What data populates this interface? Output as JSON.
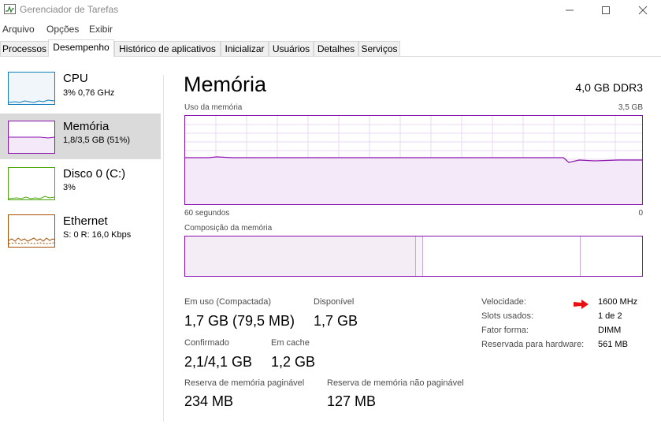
{
  "window": {
    "title": "Gerenciador de Tarefas"
  },
  "menu": [
    "Arquivo",
    "Opções",
    "Exibir"
  ],
  "tabs": [
    "Processos",
    "Desempenho",
    "Histórico de aplicativos",
    "Inicializar",
    "Usuários",
    "Detalhes",
    "Serviços"
  ],
  "active_tab": "Desempenho",
  "sidebar": {
    "items": [
      {
        "title": "CPU",
        "subtitle": "3% 0,76 GHz",
        "color": "#117dbb"
      },
      {
        "title": "Memória",
        "subtitle": "1,8/3,5 GB (51%)",
        "color": "#8b12ae"
      },
      {
        "title": "Disco 0 (C:)",
        "subtitle": "3%",
        "color": "#4da60c"
      },
      {
        "title": "Ethernet",
        "subtitle": "S: 0 R: 16,0 Kbps",
        "color": "#a74f01"
      }
    ]
  },
  "main": {
    "title": "Memória",
    "spec": "4,0 GB DDR3",
    "usage_label": "Uso da memória",
    "usage_max": "3,5 GB",
    "time_left": "60 segundos",
    "time_right": "0",
    "composition_label": "Composição da memória",
    "usage_level_fraction": 0.51,
    "composition": {
      "in_use_fraction": 0.505,
      "modified_fraction": 0.015,
      "standby_fraction": 0.35,
      "free_fraction": 0.13
    },
    "stats": {
      "in_use_label": "Em uso (Compactada)",
      "in_use_value": "1,7 GB (79,5 MB)",
      "available_label": "Disponível",
      "available_value": "1,7 GB",
      "committed_label": "Confirmado",
      "committed_value": "2,1/4,1 GB",
      "cached_label": "Em cache",
      "cached_value": "1,2 GB",
      "paged_label": "Reserva de memória paginável",
      "paged_value": "234 MB",
      "nonpaged_label": "Reserva de memória não paginável",
      "nonpaged_value": "127 MB"
    },
    "info": {
      "speed_label": "Velocidade:",
      "speed_value": "1600 MHz",
      "slots_label": "Slots usados:",
      "slots_value": "1 de 2",
      "form_label": "Fator forma:",
      "form_value": "DIMM",
      "reserved_label": "Reservada para hardware:",
      "reserved_value": "561 MB"
    }
  },
  "colors": {
    "memory": "#8b12ae",
    "annotation_arrow": "#e81010"
  }
}
